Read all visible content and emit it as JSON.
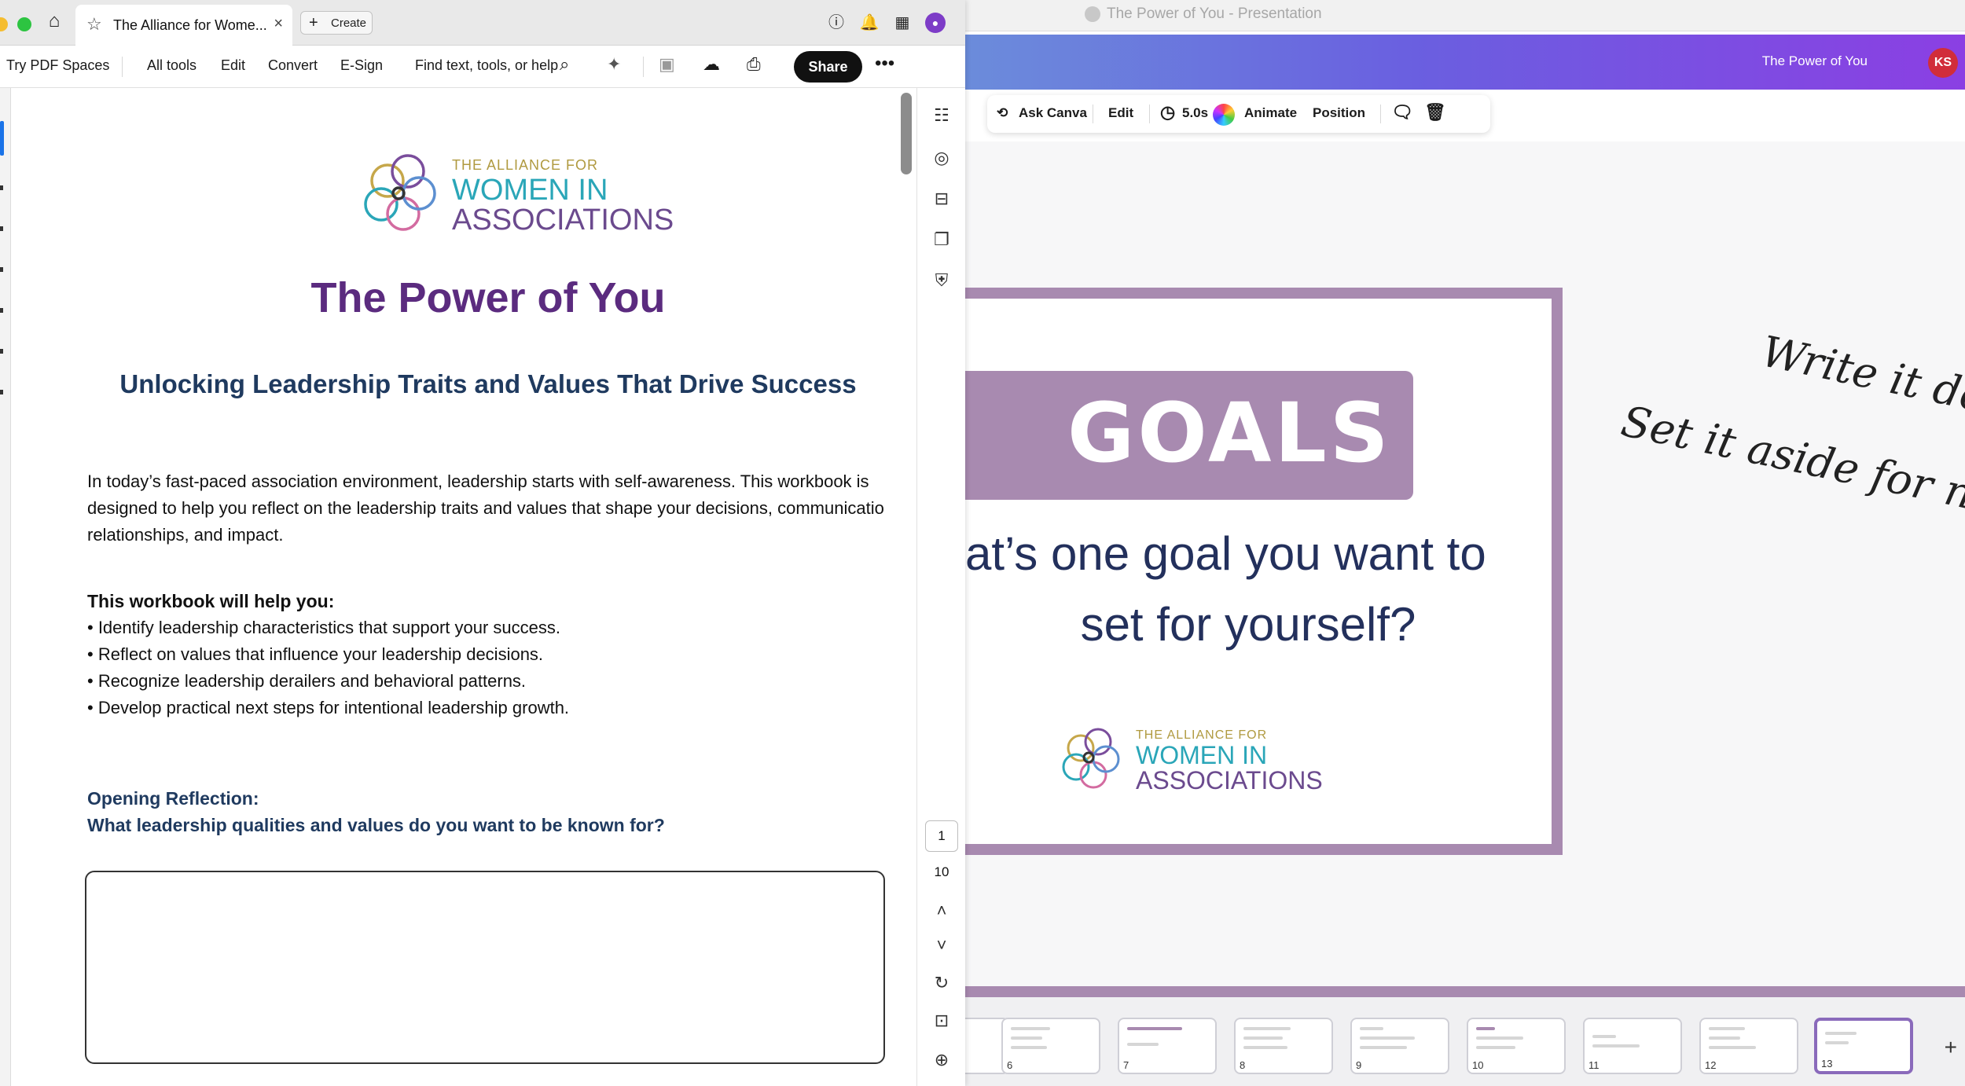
{
  "pdf_viewer": {
    "tab_title": "The Alliance for Wome...",
    "create_label": "Create",
    "toolbar": {
      "try_spaces": "Try PDF Spaces",
      "all_tools": "All tools",
      "edit": "Edit",
      "convert": "Convert",
      "esign": "E-Sign",
      "find": "Find text, tools, or help",
      "share": "Share"
    },
    "page_current": "1",
    "page_total": "10"
  },
  "document": {
    "logo_top": "THE ALLIANCE FOR",
    "logo_mid": "WOMEN IN",
    "logo_bottom": "ASSOCIATIONS",
    "title": "The Power of You",
    "subtitle": "Unlocking Leadership Traits and Values That Drive Success",
    "intro_line1": "In today’s fast-paced association environment, leadership starts with self-awareness. This workbook is",
    "intro_line2": "designed to help you reflect on the leadership traits and values that shape your decisions, communicatio",
    "intro_line3": "relationships, and impact.",
    "help_heading": "This workbook will help you:",
    "bullets": [
      "• Identify leadership characteristics that support your success.",
      "• Reflect on values that influence your leadership decisions.",
      "• Recognize leadership derailers and behavioral patterns.",
      "• Develop practical next steps for intentional leadership growth."
    ],
    "opening_heading": "Opening Reflection:",
    "opening_question": "What leadership qualities and values do you want to be known for?"
  },
  "presentation": {
    "window_title": "The Power of You - Presentation",
    "doc_title": "The Power of You",
    "user_initials": "KS",
    "toolbar": {
      "ask": "Ask Canva",
      "edit": "Edit",
      "duration": "5.0s",
      "animate": "Animate",
      "position": "Position"
    },
    "slide": {
      "banner": "GOALS",
      "question_line1": "at’s one goal you want to",
      "question_line2": "set for yourself?",
      "logo_top": "THE ALLIANCE FOR",
      "logo_mid": "WOMEN IN",
      "logo_bottom": "ASSOCIATIONS"
    },
    "handwriting_line1": "Write it down.",
    "handwriting_line2": "Set it aside for now.",
    "thumbnails": [
      "6",
      "7",
      "8",
      "9",
      "10",
      "11",
      "12",
      "13"
    ]
  },
  "colors": {
    "brand_purple": "#5b2b7f",
    "slide_lilac": "#a88ab0",
    "navy": "#1f3a5f"
  }
}
